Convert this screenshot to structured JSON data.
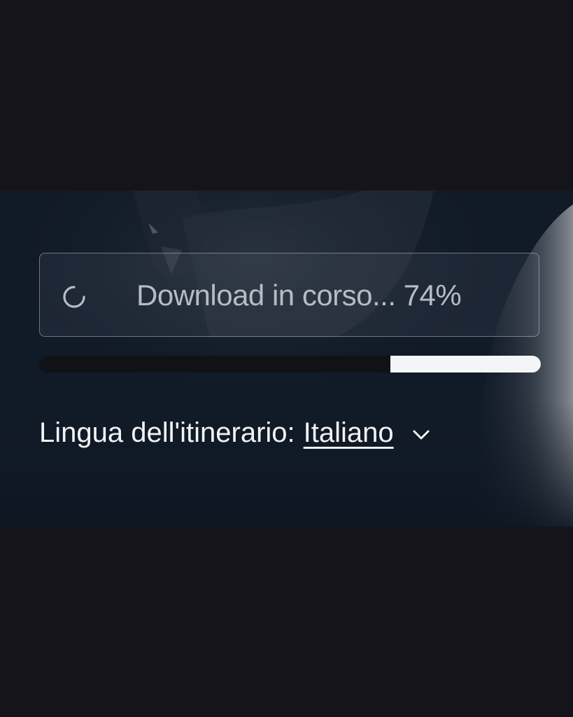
{
  "download": {
    "status_text": "Download in corso... 74%",
    "progress": 0.3,
    "spinner_icon": "spinner-icon"
  },
  "language": {
    "label": "Lingua dell'itinerario:",
    "value": "Italiano",
    "dropdown_icon": "chevron-down-icon"
  },
  "colors": {
    "background": "#15141a",
    "panel": "#111a27",
    "progress_fill": "#f4f5f7",
    "progress_track": "#111216",
    "text": "#f2f3f5",
    "muted_text": "#b7bcc4"
  }
}
